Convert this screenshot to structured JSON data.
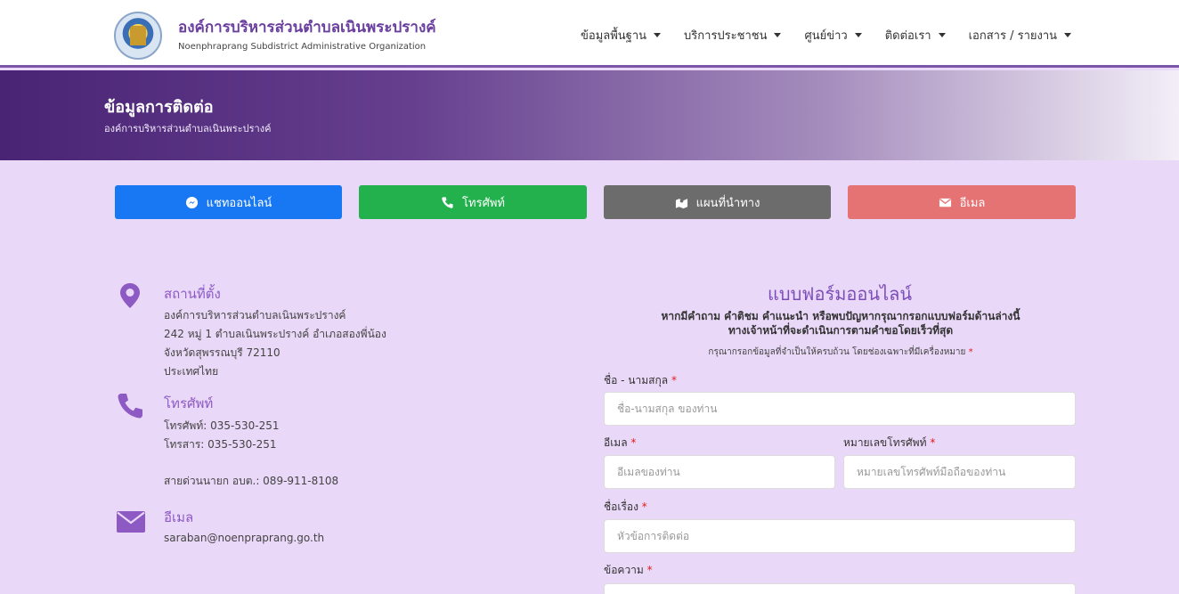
{
  "header": {
    "title": "องค์การบริหารส่วนตำบลเนินพระปรางค์",
    "subtitle": "Noenphraprang Subdistrict Administrative Organization",
    "nav": [
      "ข้อมูลพื้นฐาน",
      "บริการประชาชน",
      "ศูนย์ข่าว",
      "ติดต่อเรา",
      "เอกสาร / รายงาน"
    ]
  },
  "banner": {
    "title": "ข้อมูลการติดต่อ",
    "subtitle": "องค์การบริหารส่วนตำบลเนินพระปรางค์"
  },
  "quick_buttons": [
    {
      "label": "แชทออนไลน์",
      "color": "#1877f2",
      "icon": "messenger-icon"
    },
    {
      "label": "โทรศัพท์",
      "color": "#22b14c",
      "icon": "phone-icon"
    },
    {
      "label": "แผนที่นำทาง",
      "color": "#6c6c6c",
      "icon": "map-icon"
    },
    {
      "label": "อีเมล",
      "color": "#e57373",
      "icon": "mail-icon"
    }
  ],
  "contact": {
    "location": {
      "title": "สถานที่ตั้ง",
      "lines": [
        "องค์การบริหารส่วนตำบลเนินพระปรางค์",
        "242 หมู่ 1 ตำบลเนินพระปรางค์ อำเภอสองพี่น้อง",
        "จังหวัดสุพรรณบุรี 72110",
        "ประเทศไทย"
      ]
    },
    "phone": {
      "title": "โทรศัพท์",
      "lines": [
        "โทรศัพท์: 035-530-251",
        "โทรสาร: 035-530-251",
        "สายด่วนนายก อบต.: 089-911-8108"
      ]
    },
    "email": {
      "title": "อีเมล",
      "lines": [
        "saraban@noenpraprang.go.th"
      ]
    }
  },
  "form": {
    "title": "แบบฟอร์มออนไลน์",
    "desc_line1": "หากมีคำถาม คำติชม คำแนะนำ หรือพบปัญหากรุณากรอกแบบฟอร์มด้านล่างนี้",
    "desc_line2": "ทางเจ้าหน้าที่จะดำเนินการตามคำขอโดยเร็วที่สุด",
    "note": "กรุณากรอกข้อมูลที่จำเป็นให้ครบถ้วน โดยช่องเฉพาะที่มีเครื่องหมาย",
    "required_mark": "*",
    "name_label": "ชื่อ - นามสกุล",
    "name_placeholder": "ชื่อ-นามสกุล ของท่าน",
    "email_label": "อีเมล",
    "email_placeholder": "อีเมลของท่าน",
    "phone_label": "หมายเลขโทรศัพท์",
    "phone_placeholder": "หมายเลขโทรศัพท์มือถือของท่าน",
    "subject_label": "ชื่อเรื่อง",
    "subject_placeholder": "หัวข้อการติดต่อ",
    "message_label": "ข้อความ"
  }
}
